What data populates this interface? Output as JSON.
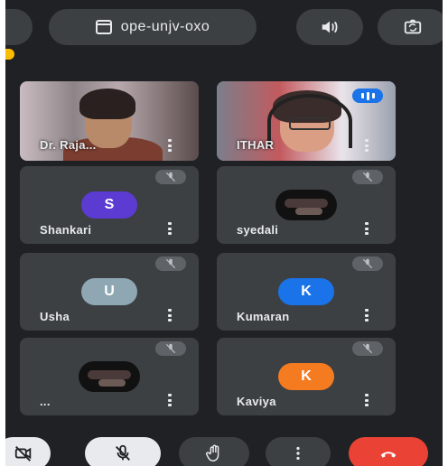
{
  "meeting": {
    "code": "ope-unjv-oxo"
  },
  "colors": {
    "background": "#202124",
    "tile": "#3c4043",
    "speaking_indicator": "#1a73e8",
    "leave_button": "#ea4335",
    "avatar_S": "#5b3bd1",
    "avatar_U": "#8fa7b3",
    "avatar_K1": "#1a73e8",
    "avatar_K2": "#f47b20"
  },
  "top_bar": {
    "icons": [
      "calendar-icon",
      "speaker-icon",
      "camera-flip-icon"
    ]
  },
  "participants": [
    {
      "name": "Dr. Raja...",
      "type": "video",
      "muted": false
    },
    {
      "name": "ITHAR",
      "type": "video",
      "muted": false,
      "speaking": true
    },
    {
      "name": "Shankari",
      "type": "avatar",
      "initial": "S",
      "muted": true
    },
    {
      "name": "syedali",
      "type": "thumbnail",
      "muted": true
    },
    {
      "name": "Usha",
      "type": "avatar",
      "initial": "U",
      "muted": true
    },
    {
      "name": "Kumaran",
      "type": "avatar",
      "initial": "K",
      "muted": true
    },
    {
      "name": "...",
      "type": "thumbnail",
      "muted": true
    },
    {
      "name": "Kaviya",
      "type": "avatar",
      "initial": "K",
      "muted": true
    }
  ],
  "controls": [
    {
      "name": "camera-off-icon"
    },
    {
      "name": "mic-off-icon"
    },
    {
      "name": "raise-hand-icon"
    },
    {
      "name": "more-options-icon"
    },
    {
      "name": "end-call-icon"
    }
  ]
}
